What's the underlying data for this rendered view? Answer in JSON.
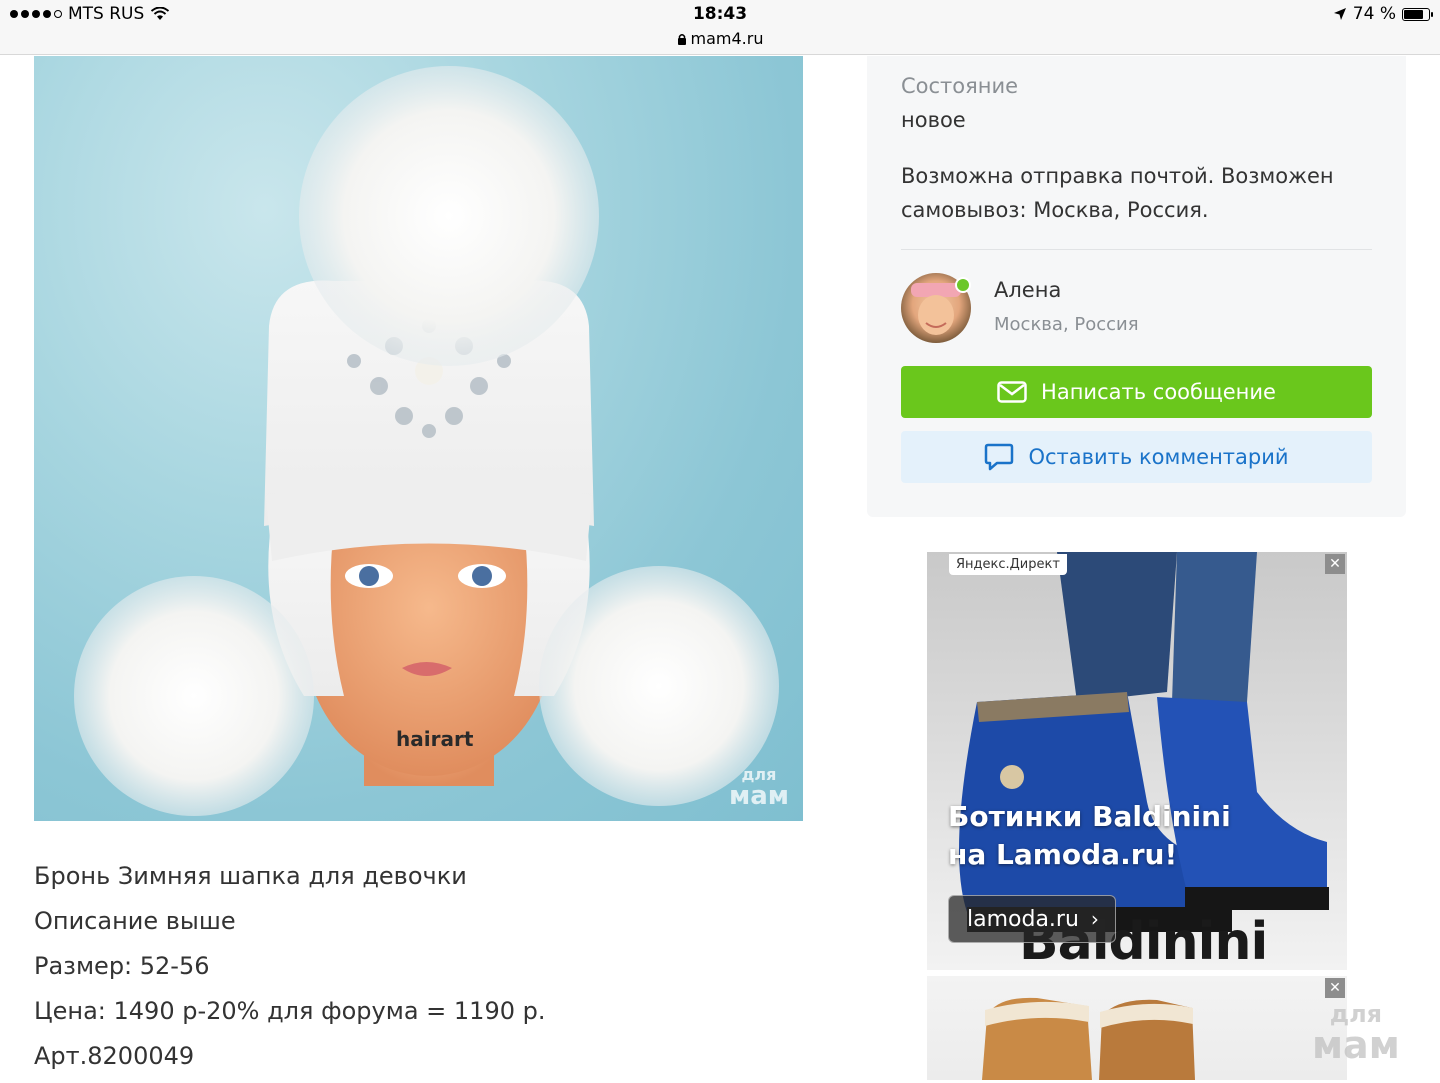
{
  "status_bar": {
    "carrier": "MTS RUS",
    "time": "18:43",
    "url": "mam4.ru",
    "battery": "74 %",
    "battery_level": 0.74
  },
  "product": {
    "image_alt": "Зимняя шапка для девочки",
    "mannequin_brand": "hairart",
    "watermark_line1": "для",
    "watermark_line2": "мам",
    "description_lines": [
      "Бронь Зимняя шапка для девочки",
      "Описание выше",
      "Размер: 52-56",
      "Цена: 1490 р-20% для форума = 1190 р.",
      "Арт.8200049"
    ]
  },
  "details": {
    "condition_label": "Состояние",
    "condition_value": "новое",
    "delivery": "Возможна отправка почтой. Возможен самовывоз: Москва, Россия."
  },
  "seller": {
    "name": "Алена",
    "city": "Москва, Россия",
    "online": true
  },
  "actions": {
    "message_label": "Написать сообщение",
    "comment_label": "Оставить комментарий"
  },
  "ad": {
    "label": "Яндекс.Директ",
    "close": "✕",
    "headline": "Ботинки Baldinini на Lamoda.ru!",
    "button_label": "lamoda.ru",
    "brand_print": "Baldinini"
  },
  "ad2": {
    "close": "✕"
  },
  "page_watermark": {
    "line1": "для",
    "line2": "мам"
  },
  "colors": {
    "accent_green": "#6ac71c",
    "link_blue": "#1a73c9",
    "comment_bg": "#e4f1fb",
    "muted_text": "#8a8f94"
  }
}
